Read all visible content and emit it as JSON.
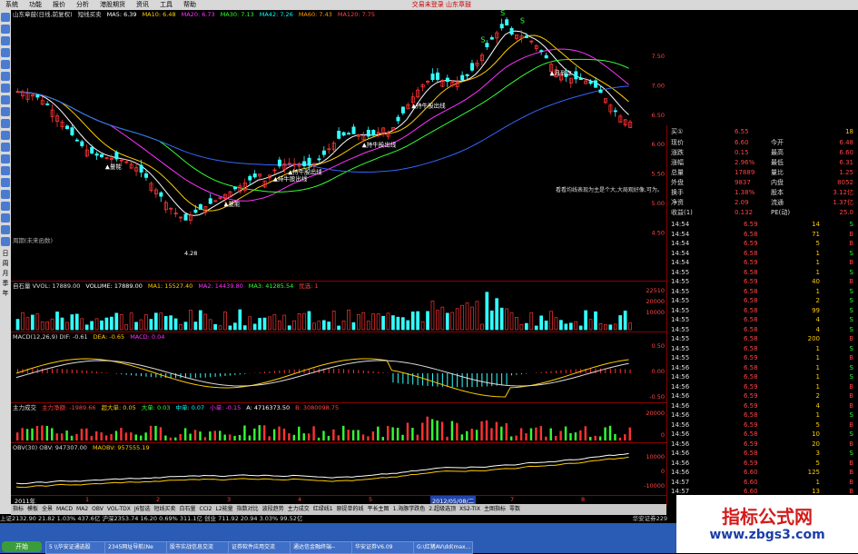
{
  "menu": {
    "items": [
      "系统",
      "功能",
      "报价",
      "分析",
      "港股期货",
      "资讯",
      "工具",
      "帮助"
    ],
    "right_text": "交易未登录  山东章鼓"
  },
  "left_toolbar": {
    "labels": [
      "日",
      "周",
      "月",
      "季",
      "年"
    ]
  },
  "price_panel": {
    "header": [
      "山东章鼓(日线,前复权)",
      "短线买卖",
      "MA5: 6.39",
      "MA10: 6.48",
      "MA20: 6.73",
      "MA30: 7.13",
      "MA42: 7.26",
      "MA60: 7.43",
      "MA120: 7.75"
    ],
    "axis_labels": [
      "7.50",
      "7.00",
      "6.50",
      "6.00",
      "5.50",
      "5.00",
      "4.50"
    ],
    "low_label": "4.28",
    "sub_caption": "周期(未来函数)",
    "annotations": [
      "▲量能",
      "▲量能",
      "▲持牛股出线",
      "▲持牛股出线",
      "▲持牛股出线",
      "▲持牛股出线",
      "▲月到点",
      "S",
      "S",
      "S"
    ],
    "note_text": "看看均线表现为主是个大,大局观好像,可为。"
  },
  "volume_panel": {
    "header": [
      "自石量 VVOL: 17889.00",
      "VOLUME: 17889.00",
      "MA1: 15527.40",
      "MA2: 14439.80",
      "MA3: 41285.54",
      "优选: 1"
    ],
    "axis_labels": [
      "22510",
      "20000",
      "10000"
    ]
  },
  "macd_panel": {
    "header": [
      "MACD(12,26,9) DIF: -0.61",
      "DEA: -0.65",
      "MACD: 0.04"
    ],
    "axis_labels": [
      "0.50",
      "0.00",
      "-0.50"
    ]
  },
  "flow_panel": {
    "header": [
      "主力成交",
      "主力净额: -1989.66",
      "超大单: 0.05",
      "大单: 0.03",
      "中单: 0.07",
      "小单: -0.15",
      "A: 4716373.50",
      "B: 3080098.75"
    ],
    "axis_labels": [
      "20000",
      "0"
    ]
  },
  "obv_panel": {
    "header": [
      "OBV(30) OBV: 947307.00",
      "MAOBV: 957555.19"
    ],
    "axis_labels": [
      "10000",
      "0",
      "-10000"
    ]
  },
  "date_bar": {
    "labels": [
      "2011年",
      "1",
      "2",
      "3",
      "4",
      "5",
      "6",
      "7",
      "8"
    ],
    "cursor_date": "2012/05/08/二"
  },
  "bottom_tabs": [
    "指标",
    "模板",
    "全景",
    "MACD",
    "MA2",
    "OBV",
    "VOL-TDX",
    "J6智选",
    "短线买卖",
    "白石量",
    "CCI2",
    "L2能量",
    "指数对比",
    "波段趋势",
    "主力成交",
    "红绿线1",
    "原捉单的线",
    "平长主图",
    "1.海豚学跌色",
    "2.超级选顶",
    "XS2-TIX",
    "主图指标",
    "零数"
  ],
  "quote": {
    "buy_label": "买①",
    "buy_price": "6.55",
    "buy_vol": "18",
    "rows": [
      {
        "l1": "现价",
        "v1": "6.60",
        "l2": "今开",
        "v2": "6.48"
      },
      {
        "l1": "涨跌",
        "v1": "0.15",
        "l2": "最高",
        "v2": "6.60"
      },
      {
        "l1": "涨幅",
        "v1": "2.96%",
        "l2": "最低",
        "v2": "6.31"
      },
      {
        "l1": "总量",
        "v1": "17889",
        "l2": "量比",
        "v2": "1.25"
      },
      {
        "l1": "外盘",
        "v1": "9837",
        "l2": "内盘",
        "v2": "8052"
      },
      {
        "l1": "换手",
        "v1": "1.38%",
        "l2": "股本",
        "v2": "3.12亿"
      },
      {
        "l1": "净资",
        "v1": "2.09",
        "l2": "流通",
        "v2": "1.37亿"
      },
      {
        "l1": "收益(1)",
        "v1": "0.132",
        "l2": "PE(动)",
        "v2": "25.0"
      }
    ]
  },
  "ticks": [
    {
      "t": "14:54",
      "p": "6.59",
      "v": "14",
      "f": "S"
    },
    {
      "t": "14:54",
      "p": "6.58",
      "v": "71",
      "f": "B"
    },
    {
      "t": "14:54",
      "p": "6.59",
      "v": "5",
      "f": "B"
    },
    {
      "t": "14:54",
      "p": "6.58",
      "v": "1",
      "f": "S"
    },
    {
      "t": "14:54",
      "p": "6.59",
      "v": "1",
      "f": "B"
    },
    {
      "t": "14:55",
      "p": "6.58",
      "v": "1",
      "f": "S"
    },
    {
      "t": "14:55",
      "p": "6.59",
      "v": "40",
      "f": "B"
    },
    {
      "t": "14:55",
      "p": "6.58",
      "v": "1",
      "f": "S"
    },
    {
      "t": "14:55",
      "p": "6.58",
      "v": "2",
      "f": "S"
    },
    {
      "t": "14:55",
      "p": "6.58",
      "v": "99",
      "f": "S"
    },
    {
      "t": "14:55",
      "p": "6.58",
      "v": "4",
      "f": "S"
    },
    {
      "t": "14:55",
      "p": "6.58",
      "v": "4",
      "f": "S"
    },
    {
      "t": "14:55",
      "p": "6.58",
      "v": "200",
      "f": "B"
    },
    {
      "t": "14:55",
      "p": "6.58",
      "v": "1",
      "f": "S"
    },
    {
      "t": "14:55",
      "p": "6.59",
      "v": "1",
      "f": "B"
    },
    {
      "t": "14:56",
      "p": "6.58",
      "v": "1",
      "f": "S"
    },
    {
      "t": "14:56",
      "p": "6.58",
      "v": "1",
      "f": "S"
    },
    {
      "t": "14:56",
      "p": "6.59",
      "v": "1",
      "f": "B"
    },
    {
      "t": "14:56",
      "p": "6.59",
      "v": "2",
      "f": "B"
    },
    {
      "t": "14:56",
      "p": "6.59",
      "v": "4",
      "f": "B"
    },
    {
      "t": "14:56",
      "p": "6.58",
      "v": "1",
      "f": "S"
    },
    {
      "t": "14:56",
      "p": "6.59",
      "v": "5",
      "f": "B"
    },
    {
      "t": "14:56",
      "p": "6.58",
      "v": "10",
      "f": "S"
    },
    {
      "t": "14:56",
      "p": "6.59",
      "v": "20",
      "f": "B"
    },
    {
      "t": "14:56",
      "p": "6.58",
      "v": "3",
      "f": "S"
    },
    {
      "t": "14:56",
      "p": "6.59",
      "v": "5",
      "f": "B"
    },
    {
      "t": "14:56",
      "p": "6.60",
      "v": "125",
      "f": "B"
    },
    {
      "t": "14:57",
      "p": "6.60",
      "v": "1",
      "f": "B"
    },
    {
      "t": "14:57",
      "p": "6.60",
      "v": "13",
      "f": "B"
    }
  ],
  "status": {
    "text": "上证2132.90  21.82  1.03%  437.6亿   沪深2353.74  16.20  0.69%  311.1亿   创业  711.92  20.94  3.03%  99.52亿",
    "broker": "华安证券229"
  },
  "taskbar": {
    "start": "开始",
    "items": [
      "5 \\\\华安证通选股",
      "2345网址导航(Ne",
      "股市实战信息交流",
      "证券软件应用交流",
      "通达信金融终端--",
      "华安证券V6.09",
      "G:\\红猪AV\\dd(max..."
    ]
  },
  "watermark": {
    "title": "指标公式网",
    "url": "www.zbgs3.com"
  }
}
